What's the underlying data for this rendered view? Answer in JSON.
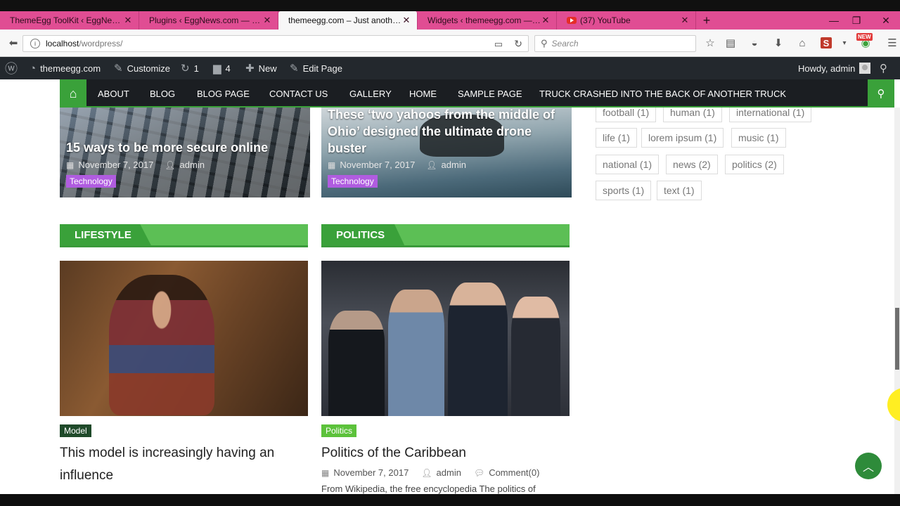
{
  "browser": {
    "tabs": [
      {
        "label": "ThemeEgg ToolKit ‹ EggNews....",
        "active": false
      },
      {
        "label": "Plugins ‹ EggNews.com — Wo...",
        "active": false
      },
      {
        "label": "themeegg.com – Just another ...",
        "active": true
      },
      {
        "label": "Widgets ‹ themeegg.com — ...",
        "active": false
      },
      {
        "label": "(37) YouTube",
        "active": false,
        "icon": "youtube-icon"
      }
    ],
    "url_host": "localhost",
    "url_path": "/wordpress/",
    "search_placeholder": "Search",
    "new_badge": "NEW",
    "s_label": "S"
  },
  "admin_bar": {
    "site": "themeegg.com",
    "customize": "Customize",
    "updates": "1",
    "comments": "4",
    "new": "New",
    "edit": "Edit Page",
    "howdy": "Howdy, admin"
  },
  "menu": [
    "ABOUT",
    "BLOG",
    "BLOG PAGE",
    "CONTACT US",
    "GALLERY",
    "HOME",
    "SAMPLE PAGE",
    "TRUCK CRASHED INTO THE BACK OF ANOTHER TRUCK"
  ],
  "top_cards": [
    {
      "title": "15 ways to be more secure online",
      "date": "November 7, 2017",
      "author": "admin",
      "category": "Technology"
    },
    {
      "title_lines": [
        "These ‘two yahoos from the middle of",
        "Ohio’ designed the ultimate drone",
        "buster"
      ],
      "date": "November 7, 2017",
      "author": "admin",
      "category": "Technology"
    }
  ],
  "sections": {
    "lifestyle": {
      "heading": "LIFESTYLE",
      "category": "Model",
      "title_lines": [
        "This model is increasingly having an",
        "influence"
      ]
    },
    "politics": {
      "heading": "POLITICS",
      "category": "Politics",
      "title": "Politics of the Caribbean",
      "date": "November 7, 2017",
      "author": "admin",
      "comments": "Comment(0)",
      "excerpt": "From Wikipedia, the free encyclopedia The politics of"
    }
  },
  "tags": [
    {
      "label": "football (1)"
    },
    {
      "label": "human (1)"
    },
    {
      "label": "international (1)"
    },
    {
      "label": "life (1)"
    },
    {
      "label": "lorem ipsum (1)"
    },
    {
      "label": "music (1)"
    },
    {
      "label": "national (1)"
    },
    {
      "label": "news (2)"
    },
    {
      "label": "politics (2)"
    },
    {
      "label": "sports (1)"
    },
    {
      "label": "text (1)"
    }
  ],
  "colors": {
    "accent_green": "#3aa13a",
    "tab_pink": "#e04d93",
    "admin_bar": "#23282d",
    "category_purple": "#b05ce0"
  }
}
